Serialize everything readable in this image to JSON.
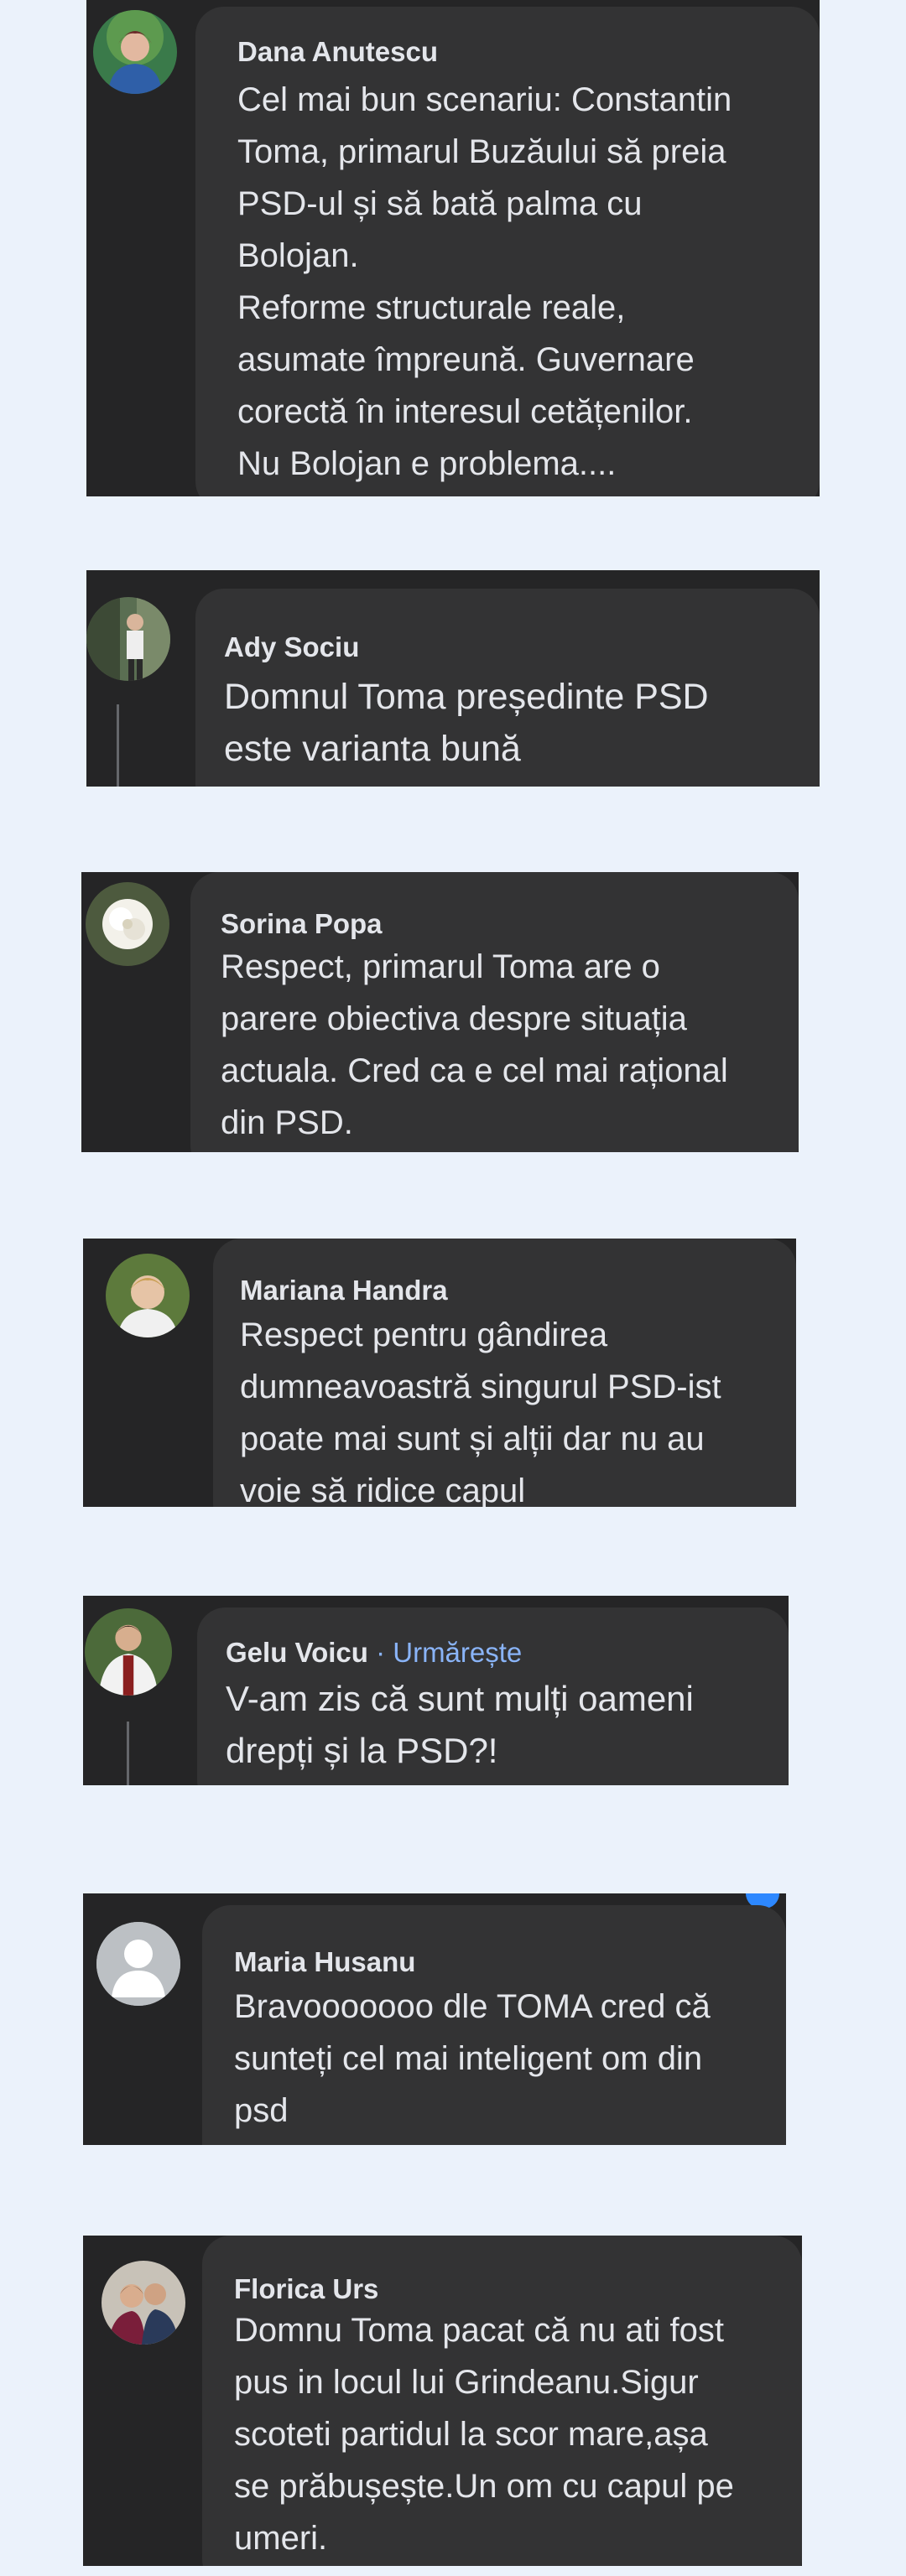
{
  "comments": [
    {
      "author": "Dana Anutescu",
      "lines": [
        "Cel mai bun scenariu: Constantin",
        "Toma, primarul Buzăului să preia",
        "PSD-ul și să bată palma cu",
        "Bolojan.",
        "Reforme structurale reale,",
        "asumate împreună. Guvernare",
        "corectă în interesul cetățenilor.",
        "Nu Bolojan e problema...."
      ]
    },
    {
      "author": "Ady Sociu",
      "lines": [
        "Domnul Toma președinte PSD",
        "este varianta bună"
      ]
    },
    {
      "author": "Sorina Popa",
      "lines": [
        "Respect, primarul Toma are o",
        "parere obiectiva despre situația",
        "actuala. Cred ca e cel mai rațional",
        "din PSD."
      ]
    },
    {
      "author": "Mariana Handra",
      "lines": [
        "Respect pentru gândirea",
        "dumneavoastră singurul PSD-ist",
        "poate mai sunt și alții dar nu au",
        "voie să ridice capul"
      ]
    },
    {
      "author": "Gelu Voicu",
      "follow": "Urmărește",
      "separator": " · ",
      "lines": [
        "V-am zis că sunt mulți oameni",
        "drepți și la PSD?!"
      ]
    },
    {
      "author": "Maria Husanu",
      "lines": [
        "Bravooooooo dle TOMA cred că",
        "sunteți cel mai inteligent om din",
        "psd"
      ]
    },
    {
      "author": "Florica Urs",
      "lines": [
        "Domnu Toma pacat că nu ati fost",
        "pus in locul lui Grindeanu.Sigur",
        "scoteti partidul la scor mare,așa",
        "se prăbușește.Un om cu capul pe",
        "umeri."
      ]
    }
  ],
  "colors": {
    "page_background": "#ebf2fb",
    "card_background": "#252526",
    "bubble_background": "#333334",
    "text": "#e4e6eb",
    "follow_link": "#8ab4f8"
  },
  "icons": [
    "avatar-photo",
    "default-avatar-icon"
  ]
}
